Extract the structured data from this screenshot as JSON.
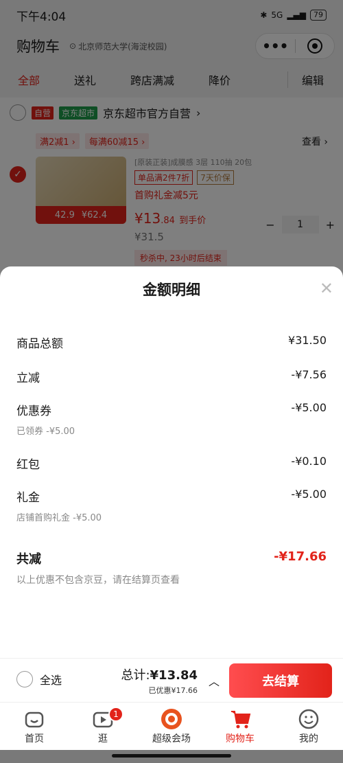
{
  "status_bar": {
    "time": "下午4:04",
    "network": "5G",
    "battery": "79"
  },
  "header": {
    "title": "购物车",
    "location": "北京师范大学(海淀校园)",
    "more_label": "•••"
  },
  "tabs": [
    "全部",
    "送礼",
    "跨店满减",
    "降价"
  ],
  "edit_label": "编辑",
  "shop": {
    "tag_self": "自营",
    "tag_market": "京东超市",
    "name": "京东超市官方自营",
    "promos": [
      "满2减1",
      "每满60减15"
    ],
    "coupon_link": "查看",
    "item": {
      "spec": "[原装正装]成膜感 3层 110抽 20包",
      "chip1": "单品满2件7折",
      "chip2": "7天价保",
      "gift": "首购礼金减5元",
      "price_main": "¥13",
      "price_dec": ".84",
      "price_note": "到手价",
      "price_orig": "¥31.5",
      "img_left": "42.9",
      "img_right": "¥62.4",
      "quantity": "1",
      "flash": "秒杀中, 23小时后结束"
    }
  },
  "sheet": {
    "title": "金额明细",
    "rows": [
      {
        "label": "商品总额",
        "value": "¥31.50"
      },
      {
        "label": "立减",
        "value": "-¥7.56"
      },
      {
        "label": "优惠券",
        "value": "-¥5.00",
        "sub": "已领券 -¥5.00"
      },
      {
        "label": "红包",
        "value": "-¥0.10"
      },
      {
        "label": "礼金",
        "value": "-¥5.00",
        "sub": "店铺首购礼金 -¥5.00"
      }
    ],
    "total_label": "共减",
    "total_value": "-¥17.66",
    "note": "以上优惠不包含京豆，请在结算页查看"
  },
  "checkout": {
    "select_all": "全选",
    "total_label": "总计:",
    "total_value": "¥13.84",
    "saved": "已优惠¥17.66",
    "button": "去结算"
  },
  "nav": {
    "items": [
      {
        "label": "首页",
        "icon": "home-icon"
      },
      {
        "label": "逛",
        "icon": "play-icon",
        "badge": "1"
      },
      {
        "label": "超级会场",
        "icon": "venue-icon"
      },
      {
        "label": "购物车",
        "icon": "cart-icon"
      },
      {
        "label": "我的",
        "icon": "profile-icon"
      }
    ]
  },
  "colors": {
    "accent": "#e2231a",
    "green_tag": "#1f9d4a",
    "overlay": "rgba(0,0,0,0.5)"
  }
}
